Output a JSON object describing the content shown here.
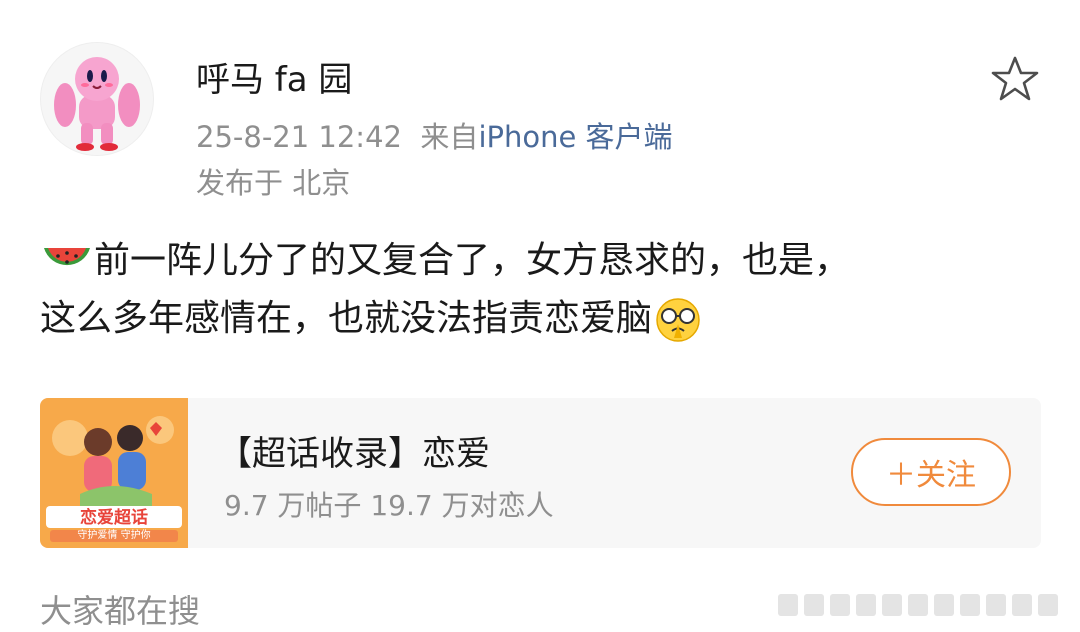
{
  "user": {
    "name": "呼马 fa 园"
  },
  "meta": {
    "timestamp": "25-8-21 12:42",
    "source_prefix": "来自",
    "client": "iPhone 客户端"
  },
  "location": {
    "text": "发布于 北京"
  },
  "post": {
    "line1": "前一阵儿分了的又复合了，女方恳求的，也是，",
    "line2": "这么多年感情在，也就没法指责恋爱脑"
  },
  "card": {
    "title": "【超话收录】恋爱",
    "stats": "9.7 万帖子 19.7 万对恋人",
    "image_banner": "恋爱超话",
    "image_sub": "守护爱情 守护你",
    "follow_label": "＋关注"
  },
  "section": {
    "title": "大家都在搜"
  },
  "icons": {
    "favorite": "star-outline-icon",
    "lead_emoji": "watermelon-icon",
    "trail_emoji": "face-with-glasses-icon"
  },
  "colors": {
    "accent": "#f08a3c",
    "link": "#4a6a99",
    "muted": "#8f8f8f"
  }
}
